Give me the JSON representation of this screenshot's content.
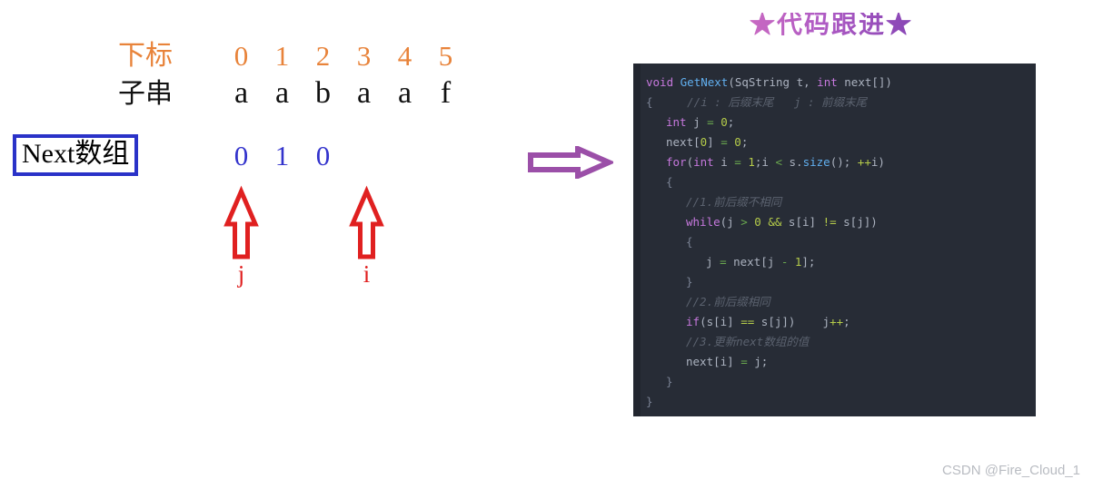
{
  "diagram": {
    "index_row_label": "下标",
    "substring_row_label": "子串",
    "next_array_label": "Next数组",
    "indices": [
      "0",
      "1",
      "2",
      "3",
      "4",
      "5"
    ],
    "substring": [
      "a",
      "a",
      "b",
      "a",
      "a",
      "f"
    ],
    "next_values": [
      "0",
      "1",
      "0"
    ],
    "pointers": [
      {
        "letter": "j",
        "index": 0
      },
      {
        "letter": "i",
        "index": 3
      }
    ],
    "colors": {
      "index": "#e8833a",
      "substring": "#111111",
      "next_value": "#3333cc",
      "next_box_border": "#2a32c8",
      "pointer": "#e02020",
      "flow_arrow": "#9b4fa8"
    }
  },
  "code_panel": {
    "title": "★代码跟进★",
    "title_gradient_from": "#d36fc0",
    "title_gradient_to": "#7a3fb0",
    "background": "#272c36",
    "lines": [
      {
        "indent": 0,
        "tokens": [
          {
            "t": "void ",
            "c": "tk-kw"
          },
          {
            "t": "GetNext",
            "c": "tk-fn"
          },
          {
            "t": "(SqString t, ",
            "c": "tk-pl"
          },
          {
            "t": "int ",
            "c": "tk-kw"
          },
          {
            "t": "next[])",
            "c": "tk-pl"
          }
        ]
      },
      {
        "indent": 0,
        "tokens": [
          {
            "t": "{",
            "c": "tk-br"
          },
          {
            "t": "     //i : 后缀末尾   j : 前缀末尾",
            "c": "tk-cmt"
          }
        ]
      },
      {
        "indent": 1,
        "tokens": [
          {
            "t": "int ",
            "c": "tk-kw"
          },
          {
            "t": "j ",
            "c": "tk-pl"
          },
          {
            "t": "= ",
            "c": "tk-op"
          },
          {
            "t": "0",
            "c": "tk-num"
          },
          {
            "t": ";",
            "c": "tk-pl"
          }
        ]
      },
      {
        "indent": 1,
        "tokens": [
          {
            "t": "next[",
            "c": "tk-pl"
          },
          {
            "t": "0",
            "c": "tk-num"
          },
          {
            "t": "] ",
            "c": "tk-pl"
          },
          {
            "t": "= ",
            "c": "tk-op"
          },
          {
            "t": "0",
            "c": "tk-num"
          },
          {
            "t": ";",
            "c": "tk-pl"
          }
        ]
      },
      {
        "indent": 1,
        "tokens": [
          {
            "t": "for",
            "c": "tk-kw"
          },
          {
            "t": "(",
            "c": "tk-pl"
          },
          {
            "t": "int ",
            "c": "tk-kw"
          },
          {
            "t": "i ",
            "c": "tk-pl"
          },
          {
            "t": "= ",
            "c": "tk-op"
          },
          {
            "t": "1",
            "c": "tk-num"
          },
          {
            "t": ";i ",
            "c": "tk-pl"
          },
          {
            "t": "< ",
            "c": "tk-op"
          },
          {
            "t": "s.",
            "c": "tk-pl"
          },
          {
            "t": "size",
            "c": "tk-fn"
          },
          {
            "t": "(); ",
            "c": "tk-pl"
          },
          {
            "t": "++",
            "c": "tk-opy"
          },
          {
            "t": "i)",
            "c": "tk-pl"
          }
        ]
      },
      {
        "indent": 1,
        "tokens": [
          {
            "t": "{",
            "c": "tk-br"
          }
        ]
      },
      {
        "indent": 2,
        "tokens": [
          {
            "t": "//1.前后缀不相同",
            "c": "tk-cmt"
          }
        ]
      },
      {
        "indent": 2,
        "tokens": [
          {
            "t": "while",
            "c": "tk-kw"
          },
          {
            "t": "(j ",
            "c": "tk-pl"
          },
          {
            "t": "> ",
            "c": "tk-op"
          },
          {
            "t": "0 ",
            "c": "tk-num"
          },
          {
            "t": "&& ",
            "c": "tk-opy"
          },
          {
            "t": "s[i] ",
            "c": "tk-pl"
          },
          {
            "t": "!= ",
            "c": "tk-opy"
          },
          {
            "t": "s[j])",
            "c": "tk-pl"
          }
        ]
      },
      {
        "indent": 2,
        "tokens": [
          {
            "t": "{",
            "c": "tk-br"
          }
        ]
      },
      {
        "indent": 3,
        "tokens": [
          {
            "t": "j ",
            "c": "tk-pl"
          },
          {
            "t": "= ",
            "c": "tk-op"
          },
          {
            "t": "next[j ",
            "c": "tk-pl"
          },
          {
            "t": "- ",
            "c": "tk-op"
          },
          {
            "t": "1",
            "c": "tk-num"
          },
          {
            "t": "];",
            "c": "tk-pl"
          }
        ]
      },
      {
        "indent": 2,
        "tokens": [
          {
            "t": "}",
            "c": "tk-br"
          }
        ]
      },
      {
        "indent": 2,
        "tokens": [
          {
            "t": "//2.前后缀相同",
            "c": "tk-cmt"
          }
        ]
      },
      {
        "indent": 2,
        "tokens": [
          {
            "t": "if",
            "c": "tk-kw"
          },
          {
            "t": "(s[i] ",
            "c": "tk-pl"
          },
          {
            "t": "== ",
            "c": "tk-opy"
          },
          {
            "t": "s[j])    j",
            "c": "tk-pl"
          },
          {
            "t": "++",
            "c": "tk-opy"
          },
          {
            "t": ";",
            "c": "tk-pl"
          }
        ]
      },
      {
        "indent": 2,
        "tokens": [
          {
            "t": "//3.更新next数组的值",
            "c": "tk-cmt"
          }
        ]
      },
      {
        "indent": 2,
        "tokens": [
          {
            "t": "next[i] ",
            "c": "tk-pl"
          },
          {
            "t": "= ",
            "c": "tk-op"
          },
          {
            "t": "j;",
            "c": "tk-pl"
          }
        ]
      },
      {
        "indent": 1,
        "tokens": [
          {
            "t": "}",
            "c": "tk-br"
          }
        ]
      },
      {
        "indent": 0,
        "tokens": [
          {
            "t": "}",
            "c": "tk-br"
          }
        ]
      }
    ]
  },
  "watermark": "CSDN @Fire_Cloud_1"
}
